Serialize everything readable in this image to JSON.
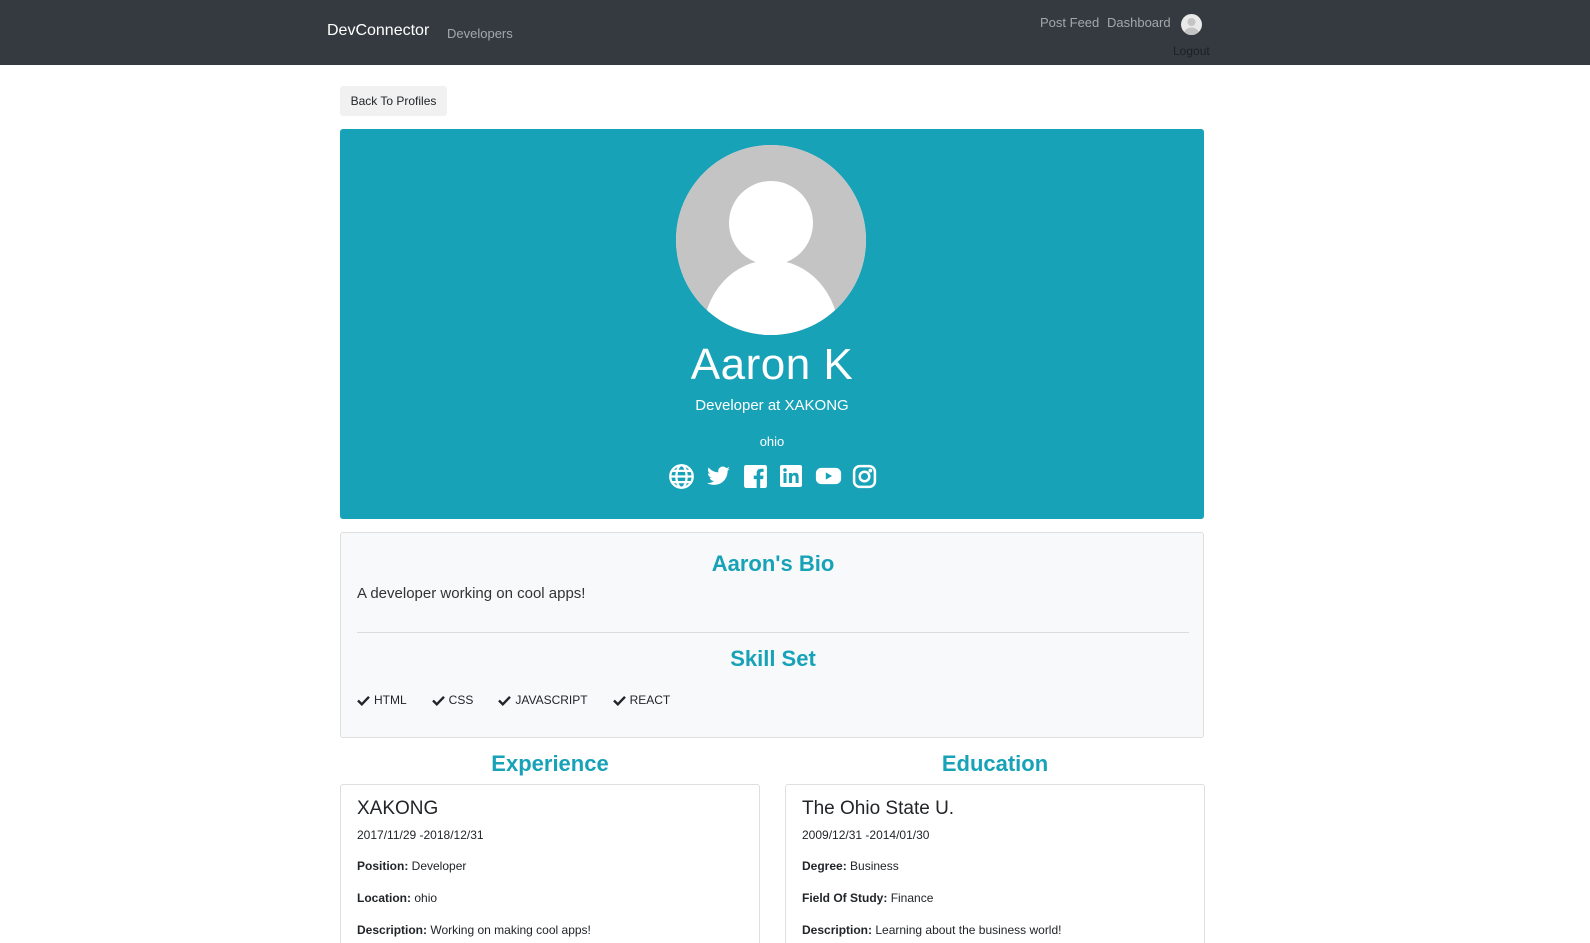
{
  "navbar": {
    "brand": "DevConnector",
    "developers_link": "Developers",
    "post_feed_link": "Post Feed",
    "dashboard_link": "Dashboard",
    "logout_link": "Logout"
  },
  "back_button": "Back To Profiles",
  "profile": {
    "name": "Aaron K",
    "status": "Developer at XAKONG",
    "location": "ohio",
    "social_icons": [
      "globe-icon",
      "twitter-icon",
      "facebook-icon",
      "linkedin-icon",
      "youtube-icon",
      "instagram-icon"
    ]
  },
  "bio": {
    "title": "Aaron's Bio",
    "text": "A developer working on cool apps!"
  },
  "skills": {
    "title": "Skill Set",
    "items": [
      "HTML",
      "CSS",
      "JAVASCRIPT",
      "REACT"
    ]
  },
  "experience": {
    "title": "Experience",
    "company": "XAKONG",
    "dates": "2017/11/29 -2018/12/31",
    "position_label": "Position:",
    "position": "Developer",
    "location_label": "Location:",
    "location": "ohio",
    "description_label": "Description:",
    "description": "Working on making cool apps!"
  },
  "education": {
    "title": "Education",
    "school": "The Ohio State U.",
    "dates": "2009/12/31 -2014/01/30",
    "degree_label": "Degree:",
    "degree": "Business",
    "field_label": "Field Of Study:",
    "field": "Finance",
    "description_label": "Description:",
    "description": "Learning about the business world!"
  },
  "colors": {
    "navbar": "#343a40",
    "accent": "#17a2b8",
    "card_bg": "#f8f9fa"
  }
}
